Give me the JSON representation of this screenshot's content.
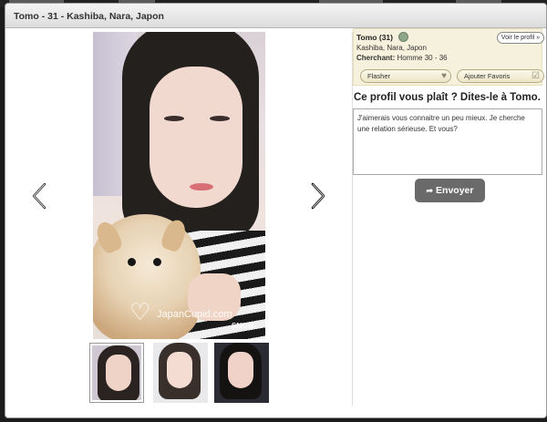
{
  "window": {
    "title": "Tomo - 31 - Kashiba, Nara, Japon"
  },
  "photo": {
    "watermark": "JapanCupid.com",
    "snow_tag": "SNOW",
    "thumbnail_count": 3,
    "active_thumbnail": 1
  },
  "icons": {
    "prev": "chevron-left-icon",
    "next": "chevron-right-icon",
    "online": "user-icon",
    "flash": "heart-icon",
    "favorite": "checkbox-icon",
    "send": "share-arrow-icon"
  },
  "profile": {
    "name_age": "Tomo (31)",
    "location": "Kashiba, Nara, Japon",
    "seeking_label": "Cherchant:",
    "seeking_value": "Homme 30 - 36",
    "view_profile_label": "Voir le profil »",
    "flash_label": "Flasher",
    "favorite_label": "Ajouter Favoris"
  },
  "message": {
    "prompt": "Ce profil vous plaît ? Dites-le à Tomo.",
    "text": "J'aimerais vous connaitre un peu mieux. Je cherche une relation sérieuse. Et vous?",
    "send_label": "Envoyer"
  },
  "colors": {
    "profile_bg": "#f6f1dc",
    "send_button": "#6a6a6a",
    "online_icon": "#8fa68a"
  }
}
